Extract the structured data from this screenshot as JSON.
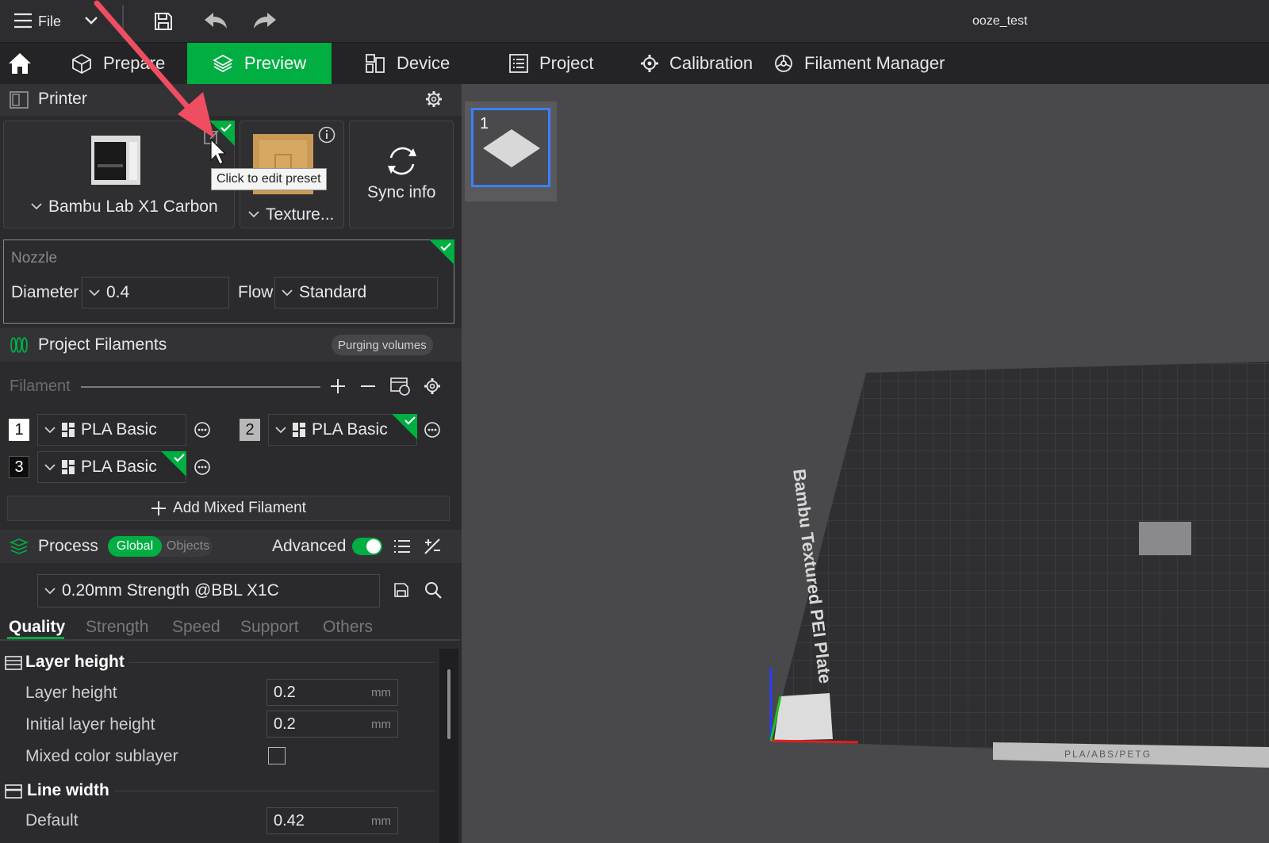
{
  "window": {
    "title": "ooze_test",
    "file_label": "File"
  },
  "tabs": [
    {
      "label": "Prepare"
    },
    {
      "label": "Preview"
    },
    {
      "label": "Device"
    },
    {
      "label": "Project"
    },
    {
      "label": "Calibration"
    },
    {
      "label": "Filament Manager"
    }
  ],
  "printer": {
    "title": "Printer",
    "printer_name": "Bambu Lab X1 Carbon",
    "plate_name": "Texture...",
    "sync_label": "Sync info",
    "tooltip": "Click to edit preset"
  },
  "nozzle": {
    "title": "Nozzle",
    "diameter_label": "Diameter",
    "diameter_value": "0.4",
    "flow_label": "Flow",
    "flow_value": "Standard"
  },
  "filaments": {
    "title": "Project Filaments",
    "purging_label": "Purging volumes",
    "column_label": "Filament",
    "items": [
      {
        "index": "1",
        "name": "PLA Basic"
      },
      {
        "index": "2",
        "name": "PLA Basic"
      },
      {
        "index": "3",
        "name": "PLA Basic"
      }
    ],
    "add_mixed_label": "Add Mixed Filament"
  },
  "process": {
    "title": "Process",
    "global_label": "Global",
    "objects_label": "Objects",
    "advanced_label": "Advanced",
    "advanced_on": true,
    "preset": "0.20mm Strength @BBL X1C",
    "tabs": [
      "Quality",
      "Strength",
      "Speed",
      "Support",
      "Others"
    ],
    "groups": {
      "layer_height": {
        "title": "Layer height",
        "rows": [
          {
            "label": "Layer height",
            "value": "0.2",
            "unit": "mm"
          },
          {
            "label": "Initial layer height",
            "value": "0.2",
            "unit": "mm"
          }
        ],
        "mixed_label": "Mixed color sublayer"
      },
      "line_width": {
        "title": "Line width",
        "default_label": "Default",
        "default_value": "0.42",
        "unit": "mm"
      }
    }
  },
  "viewport": {
    "plate_number": "1",
    "bed_label": "Bambu Textured PEI Plate",
    "bed_strip": "PLA/ABS/PETG"
  },
  "colors": {
    "accent": "#00ae42",
    "panel": "#2b2b2e",
    "viewport": "#49494b",
    "arrow": "#ee4d62"
  }
}
